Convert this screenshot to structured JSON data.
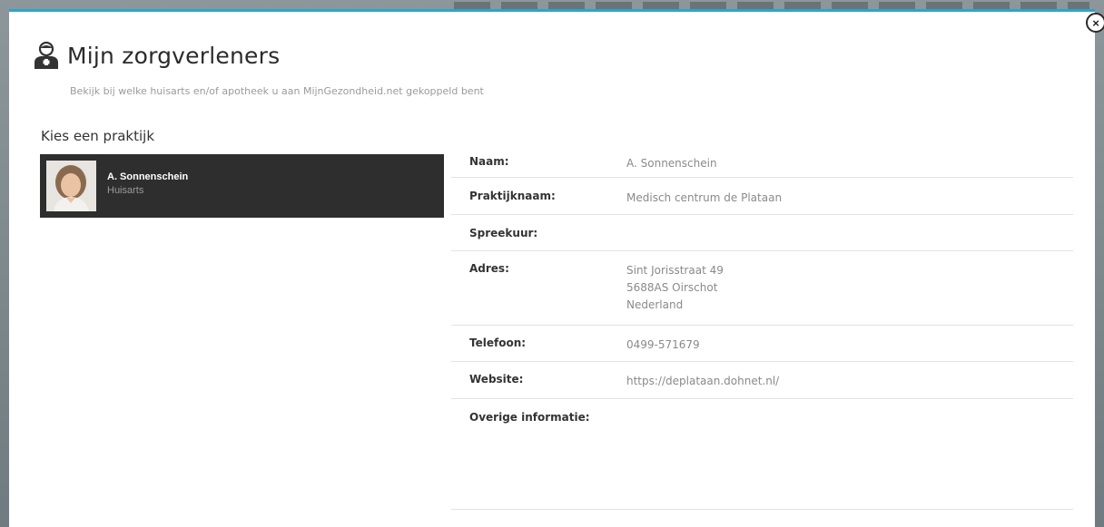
{
  "modal": {
    "title": "Mijn zorgverleners",
    "subtitle": "Bekijk bij welke huisarts en/of apotheek u aan MijnGezondheid.net gekoppeld bent",
    "close_label": "×",
    "accent_color": "#2aa6c8"
  },
  "practices": {
    "heading": "Kies een praktijk",
    "items": [
      {
        "name": "A. Sonnenschein",
        "role": "Huisarts"
      }
    ]
  },
  "details": {
    "naam": {
      "label": "Naam:",
      "value": "A. Sonnenschein"
    },
    "praktijknaam": {
      "label": "Praktijknaam:",
      "value": "Medisch centrum de Plataan"
    },
    "spreekuur": {
      "label": "Spreekuur:",
      "value": ""
    },
    "adres": {
      "label": "Adres:",
      "lines": [
        "Sint Jorisstraat 49",
        "5688AS Oirschot",
        "Nederland"
      ]
    },
    "telefoon": {
      "label": "Telefoon:",
      "value": "0499-571679"
    },
    "website": {
      "label": "Website:",
      "value": "https://deplataan.dohnet.nl/"
    },
    "overige": {
      "label": "Overige informatie:",
      "value": ""
    }
  },
  "icons": {
    "title_icon": "doctor-icon",
    "close_icon": "close-icon"
  }
}
